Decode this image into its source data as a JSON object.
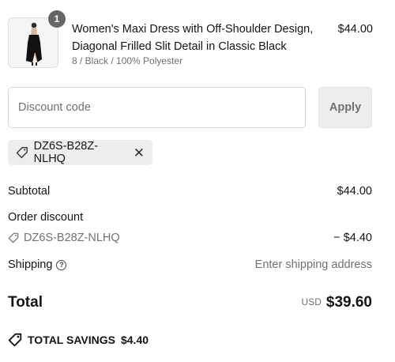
{
  "product": {
    "quantity": "1",
    "title": "Women's Maxi Dress with Off-Shoulder Design, Diagonal Frilled Slit Detail in Classic Black",
    "variant": "8 / Black / 100% Polyester",
    "price": "$44.00",
    "image_icon": "black-dress-thumbnail"
  },
  "discount": {
    "placeholder": "Discount code",
    "value": "",
    "apply_label": "Apply",
    "applied_code": "DZ6S-B28Z-NLHQ"
  },
  "summary": {
    "subtotal_label": "Subtotal",
    "subtotal_value": "$44.00",
    "order_discount_label": "Order discount",
    "discount_code": "DZ6S-B28Z-NLHQ",
    "discount_value": "− $4.40",
    "shipping_label": "Shipping",
    "shipping_value": "Enter shipping address",
    "total_label": "Total",
    "currency": "USD",
    "total_value": "$39.60",
    "savings_label": "TOTAL SAVINGS",
    "savings_value": "$4.40"
  }
}
